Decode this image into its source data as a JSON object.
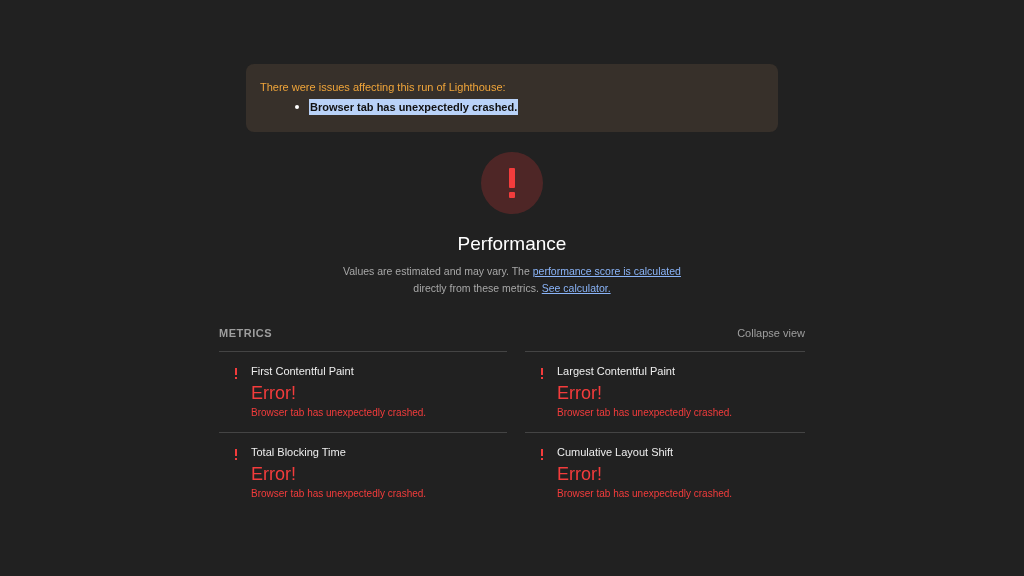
{
  "warning": {
    "title": "There were issues affecting this run of Lighthouse:",
    "items": [
      {
        "text": "Browser tab has unexpectedly crashed.",
        "selected": true
      }
    ]
  },
  "category": {
    "title": "Performance",
    "description_parts": [
      {
        "kind": "text",
        "text": "Values are estimated and may vary. The "
      },
      {
        "kind": "link",
        "text": "performance score is calculated"
      },
      {
        "kind": "break"
      },
      {
        "kind": "text",
        "text": "directly from these metrics. "
      },
      {
        "kind": "link",
        "text": "See calculator."
      }
    ]
  },
  "metrics": {
    "title": "METRICS",
    "toggle": "Collapse view",
    "items": [
      {
        "name": "First Contentful Paint",
        "kind": "error",
        "value": "Error!",
        "message": "Browser tab has unexpectedly crashed."
      },
      {
        "name": "Largest Contentful Paint",
        "kind": "error",
        "value": "Error!",
        "message": "Browser tab has unexpectedly crashed."
      },
      {
        "name": "Total Blocking Time",
        "kind": "error",
        "value": "Error!",
        "message": "Browser tab has unexpectedly crashed."
      },
      {
        "name": "Cumulative Layout Shift",
        "kind": "error",
        "value": "Error!",
        "message": "Browser tab has unexpectedly crashed."
      }
    ]
  }
}
